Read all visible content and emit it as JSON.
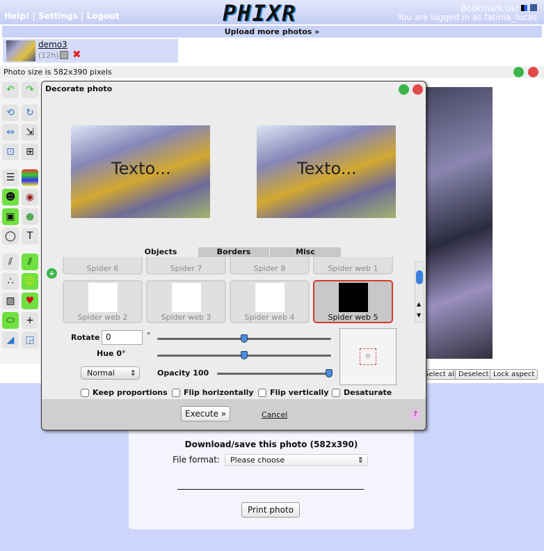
{
  "header": {
    "links": [
      "Help!",
      "Settings",
      "Logout"
    ],
    "logo": "PHIXR",
    "bookmark": "Bookmark us!",
    "logged_in": "You are logged in as fatima_lucas"
  },
  "upload": "Upload more photos »",
  "thumb": {
    "name": "demo3",
    "age": "(12h)"
  },
  "size_text": "Photo size is 582x390 pixels",
  "selection_buttons": [
    "Select all",
    "Deselect",
    "Lock aspect"
  ],
  "dialog": {
    "title": "Decorate photo",
    "preview_text": "Texto...",
    "tabs": [
      "Objects",
      "Borders",
      "Misc"
    ],
    "active_tab": "Objects",
    "items": [
      "Spider 6",
      "Spider 7",
      "Spider 8",
      "Spider web 1",
      "Spider web 2",
      "Spider web 3",
      "Spider web 4",
      "Spider web 5"
    ],
    "selected_item": "Spider web 5",
    "rotate_label": "Rotate",
    "rotate_value": "0",
    "degree": "°",
    "hue_label": "Hue 0°",
    "blend_mode": "Normal",
    "opacity_label": "Opacity 100",
    "rotate_slider": 0.5,
    "hue_slider": 0.5,
    "opacity_slider": 1.0,
    "checkboxes": [
      "Keep proportions",
      "Flip horizontally",
      "Flip vertically",
      "Desaturate"
    ],
    "execute": "Execute »",
    "cancel": "Cancel",
    "help": "?"
  },
  "download": {
    "title": "Download/save this photo (582x390)",
    "format_label": "File format:",
    "format_value": "Please choose",
    "print": "Print photo"
  }
}
